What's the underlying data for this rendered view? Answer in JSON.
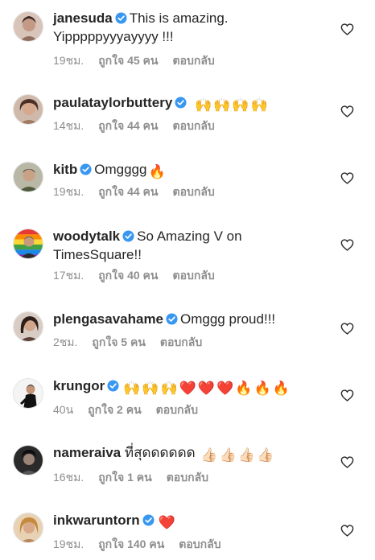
{
  "comments": [
    {
      "username": "janesuda",
      "text_line1": "This is amazing.",
      "text_line2": "Yipppppyyyayyyy !!!",
      "time": "19ชม.",
      "likes": "ถูกใจ 45 คน",
      "reply": "ตอบกลับ",
      "avatar_color": "#b89080"
    },
    {
      "username": "paulataylorbuttery",
      "text_line1": "",
      "emoji": [
        "raising-hands",
        "raising-hands",
        "raising-hands",
        "raising-hands"
      ],
      "time": "14ชม.",
      "likes": "ถูกใจ 44 คน",
      "reply": "ตอบกลับ",
      "avatar_color": "#9a7a6a"
    },
    {
      "username": "kitb",
      "text_line1": "Omgggg",
      "emoji": [
        "fire"
      ],
      "time": "19ชม.",
      "likes": "ถูกใจ 44 คน",
      "reply": "ตอบกลับ",
      "avatar_color": "#5a6a4a"
    },
    {
      "username": "woodytalk",
      "text_line1": "So Amazing V on",
      "text_line2": "TimesSquare!!",
      "time": "17ชม.",
      "likes": "ถูกใจ 40 คน",
      "reply": "ตอบกลับ",
      "avatar_color": "#4a6ac0"
    },
    {
      "username": "plengasavahame",
      "text_line1": "Omggg proud!!!",
      "time": "2ชม.",
      "likes": "ถูกใจ 5 คน",
      "reply": "ตอบกลับ",
      "avatar_color": "#6a5048"
    },
    {
      "username": "krungor",
      "text_line1": "",
      "emoji": [
        "raising-hands",
        "raising-hands",
        "raising-hands",
        "red-heart",
        "red-heart",
        "red-heart",
        "fire",
        "fire",
        "fire"
      ],
      "time": "40น",
      "likes": "ถูกใจ 2 คน",
      "reply": "ตอบกลับ",
      "avatar_color": "#3a3a3a"
    },
    {
      "username": "nameraiva",
      "text_line1": "ที่สุดดดดดด",
      "emoji": [
        "thumbs-up",
        "thumbs-up",
        "thumbs-up",
        "thumbs-up"
      ],
      "time": "16ชม.",
      "likes": "ถูกใจ 1 คน",
      "reply": "ตอบกลับ",
      "avatar_color": "#2a2a2a"
    },
    {
      "username": "inkwaruntorn",
      "text_line1": "",
      "emoji": [
        "red-heart"
      ],
      "time": "19ชม.",
      "likes": "ถูกใจ 140 คน",
      "reply": "ตอบกลับ",
      "avatar_color": "#c09060"
    }
  ],
  "colors": {
    "verified": "#3897f0",
    "meta_text": "#8e8e8e",
    "heart_outline": "#262626"
  }
}
